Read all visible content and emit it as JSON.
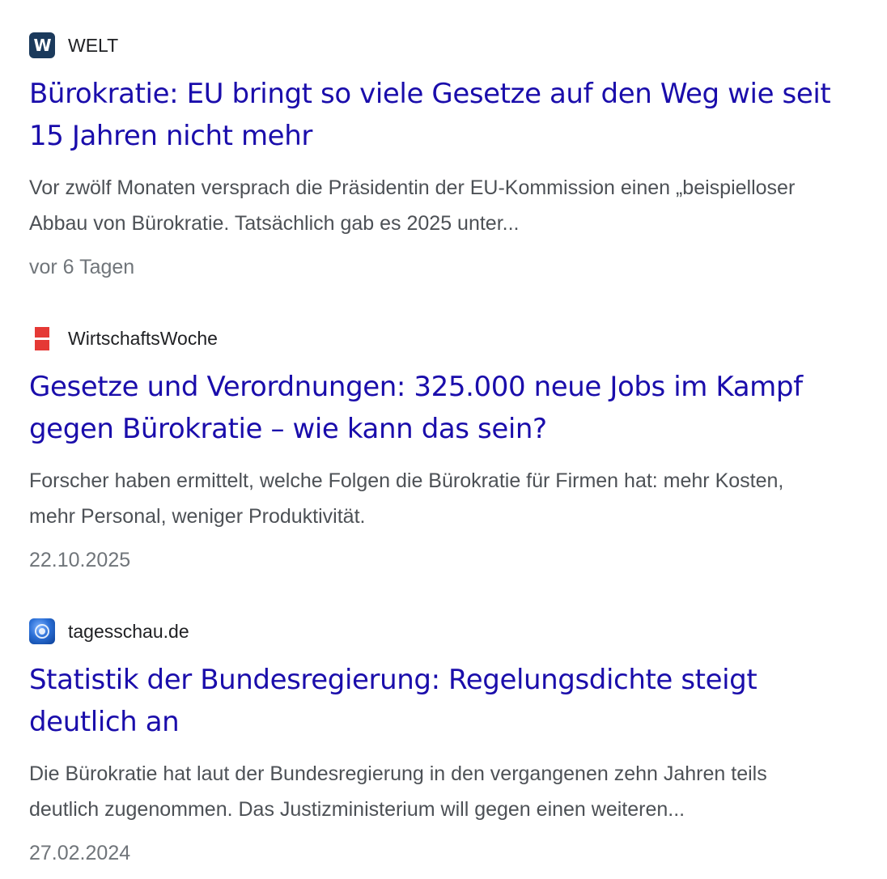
{
  "results": [
    {
      "source": "WELT",
      "favicon": "welt-logo-icon",
      "favicon_letter": "W",
      "title_lines": [
        "Bürokratie: EU bringt so viele Gesetze auf den Weg wie seit",
        "15 Jahren nicht mehr"
      ],
      "snippet_lines": [
        "Vor zwölf Monaten versprach die Präsidentin der EU-Kommission einen „beispielloser",
        "Abbau von Bürokratie. Tatsächlich gab es 2025 unter..."
      ],
      "date": "vor 6 Tagen"
    },
    {
      "source": "WirtschaftsWoche",
      "favicon": "wirtschaftswoche-logo-icon",
      "title_lines": [
        "Gesetze und Verordnungen: 325.000 neue Jobs im Kampf",
        "gegen Bürokratie – wie kann das sein?"
      ],
      "snippet_lines": [
        "Forscher haben ermittelt, welche Folgen die Bürokratie für Firmen hat: mehr Kosten,",
        "mehr Personal, weniger Produktivität."
      ],
      "date": "22.10.2025"
    },
    {
      "source": "tagesschau.de",
      "favicon": "tagesschau-globe-icon",
      "title_lines": [
        "Statistik der Bundesregierung: Regelungsdichte steigt",
        "deutlich an"
      ],
      "snippet_lines": [
        "Die Bürokratie hat laut der Bundesregierung in den vergangenen zehn Jahren teils",
        "deutlich zugenommen. Das Justizministerium will gegen einen weiteren..."
      ],
      "date": "27.02.2024"
    }
  ],
  "colors": {
    "title_link": "#1a0dab",
    "snippet_text": "#4d5156",
    "date_text": "#70757a",
    "source_text": "#202124",
    "welt_brand": "#1b3a5c",
    "wiwo_brand": "#e53935",
    "tagesschau_brand": "#2b6fd6"
  }
}
